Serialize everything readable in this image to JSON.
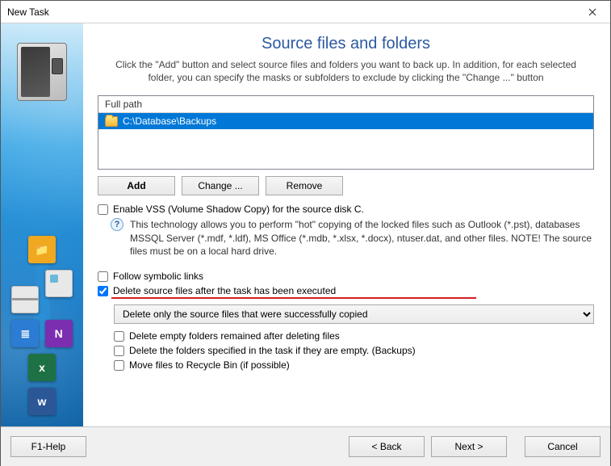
{
  "window": {
    "title": "New Task"
  },
  "page": {
    "heading": "Source files and folders",
    "intro": "Click the \"Add\" button and select source files and folders you want to back up. In addition, for each selected folder, you can specify the masks or subfolders to exclude by clicking the \"Change ...\" button"
  },
  "source_list": {
    "header": "Full path",
    "rows": [
      {
        "path": "C:\\Database\\Backups"
      }
    ]
  },
  "buttons": {
    "add": "Add",
    "change": "Change ...",
    "remove": "Remove"
  },
  "vss": {
    "label": "Enable VSS (Volume Shadow Copy) for the source disk C.",
    "checked": false,
    "info": "This technology allows you to perform \"hot\" copying of the locked files such as Outlook (*.pst), databases MSSQL Server (*.mdf, *.ldf), MS Office (*.mdb, *.xlsx, *.docx), ntuser.dat, and other files. NOTE! The source files must be on a local hard drive."
  },
  "symbolic": {
    "label": "Follow symbolic links",
    "checked": false
  },
  "delete_source": {
    "label": "Delete source files after the task has been executed",
    "checked": true
  },
  "delete_mode": {
    "selected": "Delete only the source files that were successfully copied",
    "options": [
      "Delete only the source files that were successfully copied"
    ]
  },
  "sub_options": {
    "empty_folders": {
      "label": "Delete empty folders remained after deleting files",
      "checked": false
    },
    "spec_folders": {
      "label": "Delete the folders specified in the task if they are empty. (Backups)",
      "checked": false
    },
    "recycle": {
      "label": "Move files to Recycle Bin (if possible)",
      "checked": false
    }
  },
  "nav": {
    "help": "F1-Help",
    "back": "< Back",
    "next": "Next >",
    "cancel": "Cancel"
  }
}
